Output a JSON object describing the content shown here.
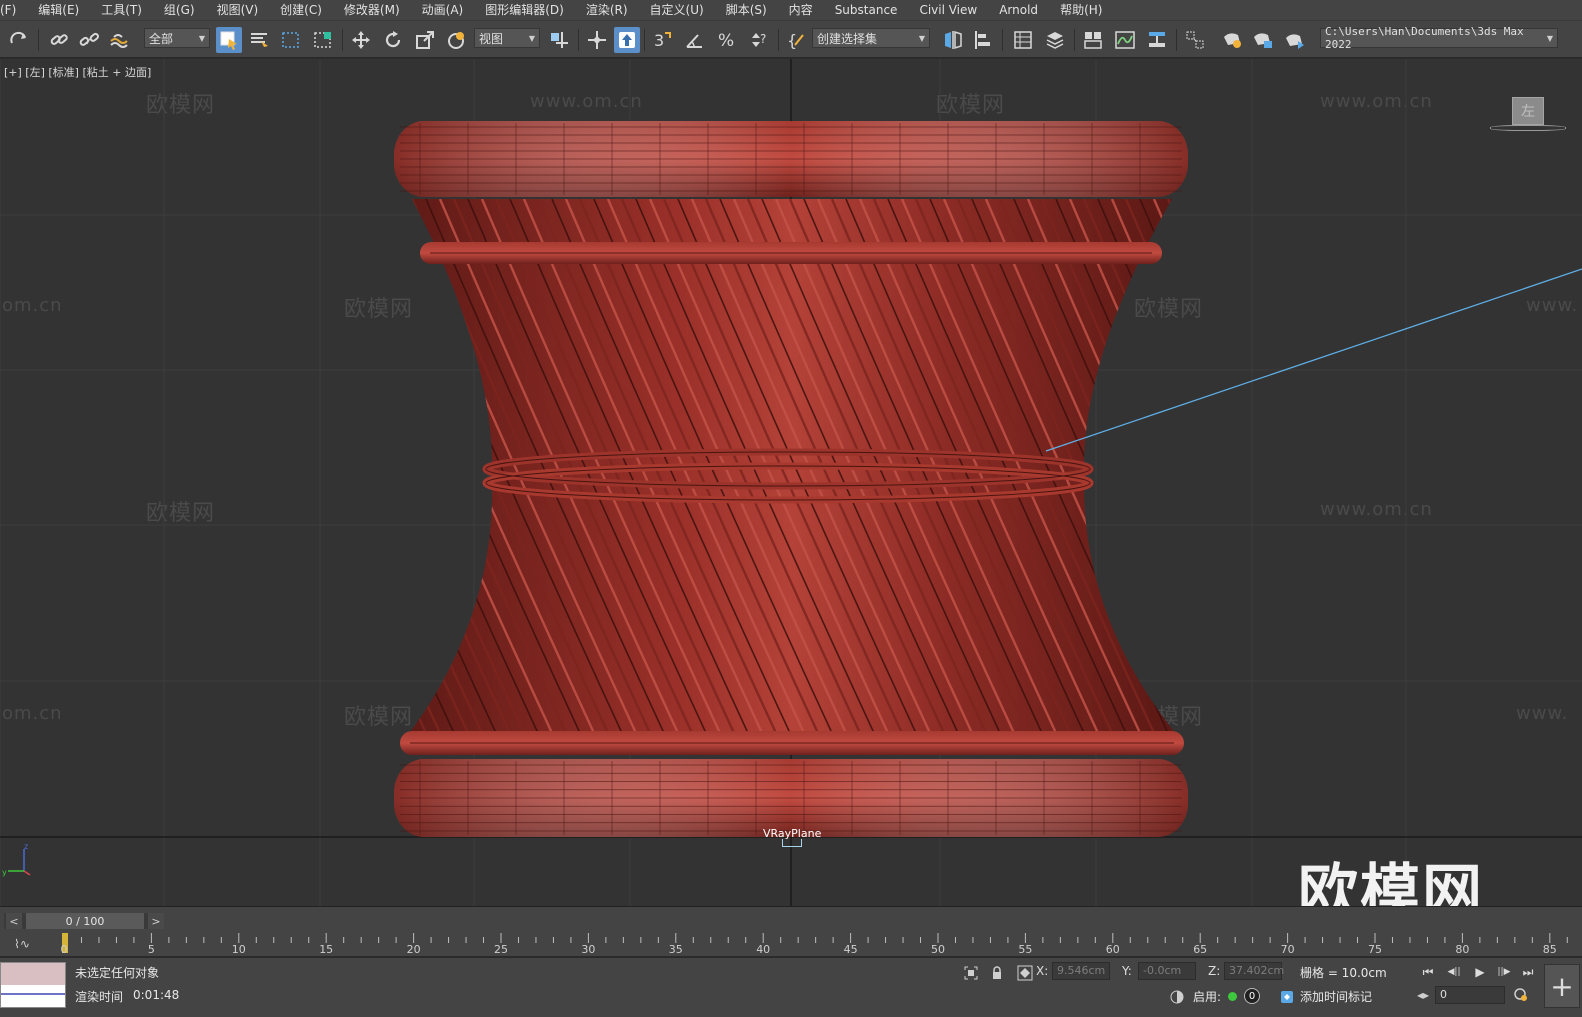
{
  "menus": [
    "(F)",
    "编辑(E)",
    "工具(T)",
    "组(G)",
    "视图(V)",
    "创建(C)",
    "修改器(M)",
    "动画(A)",
    "图形编辑器(D)",
    "渲染(R)",
    "自定义(U)",
    "脚本(S)",
    "内容",
    "Substance",
    "Civil View",
    "Arnold",
    "帮助(H)"
  ],
  "toolbar": {
    "selection_filter": "全部",
    "reference_coord": "视图",
    "named_selection": "创建选择集",
    "project_path": "C:\\Users\\Han\\Documents\\3ds Max 2022",
    "icons": {
      "redo": "redo-icon",
      "link": "link-icon",
      "unlink": "unlink-icon",
      "bind": "bind-space-warp-icon",
      "select": "select-object-icon",
      "select_by_name": "select-by-name-icon",
      "rect_region": "rectangular-selection-icon",
      "window_crossing": "window-crossing-icon",
      "move": "select-and-move-icon",
      "rotate": "select-and-rotate-icon",
      "scale": "select-and-scale-icon",
      "place": "select-and-place-icon",
      "pivot": "use-pivot-center-icon",
      "manipulate": "select-and-manipulate-icon",
      "snaps": "snaps-toggle-icon",
      "angle_snap": "angle-snap-icon",
      "percent_snap": "percent-snap-icon",
      "spinner_snap": "spinner-snap-icon",
      "edit_named": "edit-named-selection-icon",
      "mirror": "mirror-icon",
      "align": "align-icon",
      "scene_explorer": "scene-explorer-icon",
      "layer_explorer": "layer-explorer-icon",
      "ribbon": "toggle-ribbon-icon",
      "curve_editor": "curve-editor-icon",
      "schematic": "schematic-view-icon",
      "material_editor": "material-editor-icon",
      "render_setup": "render-setup-icon",
      "render_frame": "rendered-frame-window-icon",
      "render": "render-production-icon"
    }
  },
  "viewport": {
    "label": "[+] [左] [标准] [粘土 + 边面]",
    "viewcube_face": "左",
    "object_label": "VRayPlane",
    "watermark_cn": "欧模网",
    "watermark_url": "www.om.cn",
    "watermark_url_partial": "om.cn",
    "watermark_url_right": "www.",
    "watermark_big": "欧模网",
    "axis_icon": "xyz-axis-tripod-icon"
  },
  "timeline": {
    "frame_display": "0 / 100",
    "prev_arrow": "<",
    "next_arrow": ">",
    "toggle_label": "⌇∿",
    "ticks": [
      0,
      5,
      10,
      15,
      20,
      25,
      30,
      35,
      40,
      45,
      50,
      55,
      60,
      65,
      70,
      75,
      80,
      85
    ],
    "tick_label_zero": "0"
  },
  "status": {
    "prompt": "未选定任何对象",
    "render_time_label": "渲染时间",
    "render_time_value": "0:01:48",
    "x_label": "X:",
    "x_value": "9.546cm",
    "y_label": "Y:",
    "y_value": "-0.0cm",
    "z_label": "Z:",
    "z_value": "37.402cm",
    "grid": "栅格 = 10.0cm",
    "enable_label": "启用:",
    "badge": "0",
    "add_time_tag": "添加时间标记",
    "current_frame": "0",
    "playback": [
      "⏮",
      "◀||",
      "▶",
      "||▶",
      "⏭"
    ],
    "plus": "+"
  },
  "colors": {
    "ui_bg": "#444444",
    "viewport_bg": "#333333",
    "model_red": "#8a2a24",
    "active_blue": "#5b8fc9",
    "link_line": "#5fb0e8"
  }
}
